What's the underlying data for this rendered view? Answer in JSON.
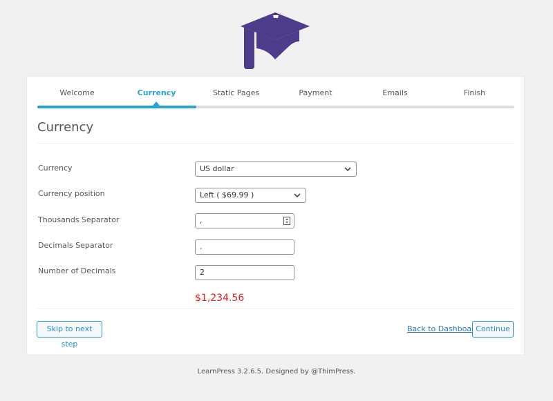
{
  "wizard": {
    "steps": [
      {
        "label": "Welcome"
      },
      {
        "label": "Currency"
      },
      {
        "label": "Static Pages"
      },
      {
        "label": "Payment"
      },
      {
        "label": "Emails"
      },
      {
        "label": "Finish"
      }
    ],
    "active_step": "Currency",
    "progress_fraction": 0.333
  },
  "section": {
    "title": "Currency"
  },
  "form": {
    "currency": {
      "label": "Currency",
      "value": "US dollar"
    },
    "currency_position": {
      "label": "Currency position",
      "value": "Left ( $69.99 )"
    },
    "thousands_separator": {
      "label": "Thousands Separator",
      "value": ","
    },
    "decimals_separator": {
      "label": "Decimals Separator",
      "value": "."
    },
    "number_of_decimals": {
      "label": "Number of Decimals",
      "value": "2"
    },
    "preview_price": "$1,234.56"
  },
  "actions": {
    "skip": "Skip to next step",
    "back": "Back to Dashboard",
    "continue": "Continue"
  },
  "footer": {
    "text": "LearnPress 3.2.6.5. Designed by @ThimPress."
  },
  "colors": {
    "accent": "#2ba2d4",
    "logo": "#4f3b8c",
    "price": "#e02020"
  },
  "icons": {
    "logo": "graduation-cap-icon",
    "select_arrow": "chevron-down-icon",
    "number_spinner": "spinner-icon"
  }
}
